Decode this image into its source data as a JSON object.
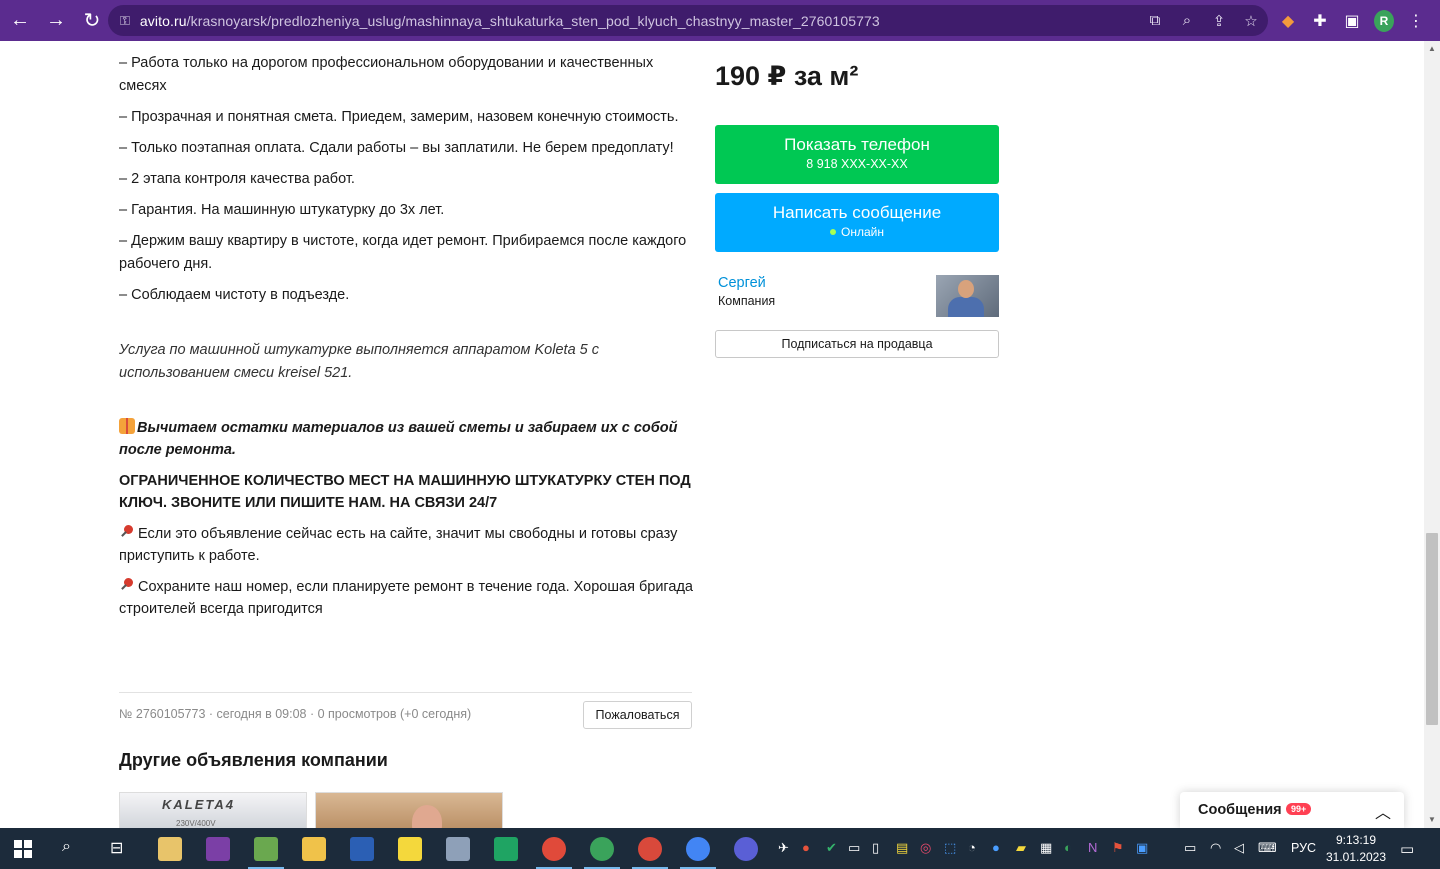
{
  "browser": {
    "url_host": "avito.ru",
    "url_path": "/krasnoyarsk/predlozheniya_uslug/mashinnaya_shtukaturka_sten_pod_klyuch_chastnyy_master_2760105773",
    "profile_initial": "R"
  },
  "description": {
    "line1": "– Работа только на дорогом профессиональном оборудовании и качественных смесях",
    "line2": "– Прозрачная и понятная смета. Приедем, замерим, назовем конечную стоимость.",
    "line3": "– Только поэтапная оплата. Сдали работы – вы заплатили. Не берем предоплату!",
    "line4": "– 2 этапа контроля качества работ.",
    "line5": "– Гарантия. На машинную штукатурку до 3х лет.",
    "line6": "– Держим вашу квартиру в чистоте, когда идет ремонт. Прибираемся после каждого рабочего дня.",
    "line7": "– Соблюдаем чистоту в подъезде.",
    "italic_note": "Услуга по машинной штукатурке выполняется аппаратом Koleta 5 с использованием смеси kreisel 521.",
    "gift_text": "Вычитаем остатки материалов из вашей сметы и забираем их с собой после ремонта.",
    "caps_text": "ОГРАНИЧЕННОЕ КОЛИЧЕСТВО МЕСТ НА МАШИННУЮ ШТУКАТУРКУ СТЕН ПОД КЛЮЧ. ЗВОНИТЕ ИЛИ ПИШИТЕ НАМ. НА СВЯЗИ 24/7",
    "pin1": "Если это объявление сейчас есть на сайте, значит мы свободны и готовы сразу приступить к работе.",
    "pin2": "Сохраните наш номер, если планируете ремонт в течение года. Хорошая бригада строителей всегда пригодится"
  },
  "meta": {
    "info": "№ 2760105773 · сегодня в 09:08 · 0 просмотров (+0 сегодня)",
    "complain_label": "Пожаловаться"
  },
  "other": {
    "title": "Другие объявления компании",
    "thumb1_brand": "KALETA4",
    "thumb1_sub": "230V/400V"
  },
  "sidebar": {
    "price": "190 ₽ за м²",
    "phone_label": "Показать телефон",
    "phone_number": "8 918 XXX-XX-XX",
    "message_label": "Написать сообщение",
    "online_label": "Онлайн",
    "seller_name": "Сергей",
    "seller_type": "Компания",
    "subscribe_label": "Подписаться на продавца"
  },
  "messages": {
    "label": "Сообщения",
    "badge": "99+"
  },
  "taskbar": {
    "lang": "РУС",
    "time": "9:13:19",
    "date": "31.01.2023"
  }
}
